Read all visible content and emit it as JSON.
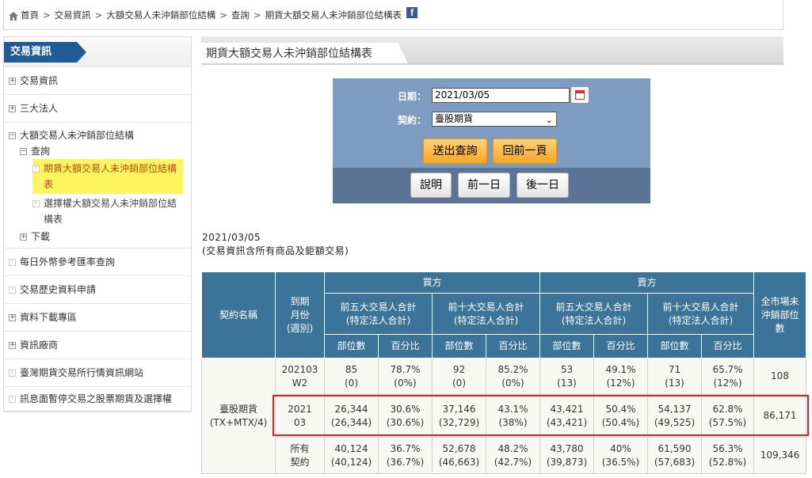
{
  "breadcrumb": [
    "首頁",
    "交易資訊",
    "大額交易人未沖銷部位結構",
    "查詢",
    "期貨大額交易人未沖銷部位結構表"
  ],
  "sidebar": {
    "title": "交易資訊",
    "items": [
      {
        "label": "交易資訊"
      },
      {
        "label": "三大法人"
      },
      {
        "label": "大額交易人未沖銷部位結構"
      },
      {
        "label": "查詢"
      },
      {
        "label": "期貨大額交易人未沖銷部位結構表"
      },
      {
        "label": "選擇權大額交易人未沖銷部位結構表"
      },
      {
        "label": "下載"
      },
      {
        "label": "每日外幣參考匯率查詢"
      },
      {
        "label": "交易歷史資料申請"
      },
      {
        "label": "資料下載專區"
      },
      {
        "label": "資訊廠商"
      },
      {
        "label": "臺灣期貨交易所行情資訊網站"
      },
      {
        "label": "訊息面暫停交易之股票期貨及選擇權"
      }
    ]
  },
  "page_title": "期貨大額交易人未沖銷部位結構表",
  "form": {
    "date_label": "日期：",
    "date_value": "2021/03/05",
    "contract_label": "契約：",
    "contract_value": "臺股期貨",
    "submit_label": "送出查詢",
    "back_label": "回前一頁",
    "help_label": "說明",
    "prev_day_label": "前一日",
    "next_day_label": "後一日"
  },
  "report_date": "2021/03/05",
  "report_note": "(交易資訊含所有商品及鉅額交易)",
  "table": {
    "headers": {
      "contract": "契約名稱",
      "month_l1": "到期",
      "month_l2": "月份",
      "month_l3": "(週別)",
      "buy": "買方",
      "sell": "賣方",
      "top5_l1": "前五大交易人合計",
      "top5_l2": "(特定法人合計)",
      "top10_l1": "前十大交易人合計",
      "top10_l2": "(特定法人合計)",
      "oi_l1": "全市場未",
      "oi_l2": "沖銷部位",
      "oi_l3": "數",
      "position": "部位數",
      "percent": "百分比"
    },
    "contract_l1": "臺股期貨",
    "contract_l2": "(TX+MTX/4)",
    "rows": [
      {
        "month_l1": "202103",
        "month_l2": "W2",
        "cells": [
          [
            "85",
            "(0)"
          ],
          [
            "78.7%",
            "(0%)"
          ],
          [
            "92",
            "(0)"
          ],
          [
            "85.2%",
            "(0%)"
          ],
          [
            "53",
            "(13)"
          ],
          [
            "49.1%",
            "(12%)"
          ],
          [
            "71",
            "(13)"
          ],
          [
            "65.7%",
            "(12%)"
          ]
        ],
        "oi": "108"
      },
      {
        "month_l1": "2021",
        "month_l2": "03",
        "cells": [
          [
            "26,344",
            "(26,344)"
          ],
          [
            "30.6%",
            "(30.6%)"
          ],
          [
            "37,146",
            "(32,729)"
          ],
          [
            "43.1%",
            "(38%)"
          ],
          [
            "43,421",
            "(43,421)"
          ],
          [
            "50.4%",
            "(50.4%)"
          ],
          [
            "54,137",
            "(49,525)"
          ],
          [
            "62.8%",
            "(57.5%)"
          ]
        ],
        "oi": "86,171"
      },
      {
        "month_l1": "所有",
        "month_l2": "契約",
        "cells": [
          [
            "40,124",
            "(40,124)"
          ],
          [
            "36.7%",
            "(36.7%)"
          ],
          [
            "52,678",
            "(46,663)"
          ],
          [
            "48.2%",
            "(42.7%)"
          ],
          [
            "43,780",
            "(39,873)"
          ],
          [
            "40%",
            "(36.5%)"
          ],
          [
            "61,590",
            "(57,683)"
          ],
          [
            "56.3%",
            "(52.8%)"
          ]
        ],
        "oi": "109,346"
      }
    ]
  }
}
